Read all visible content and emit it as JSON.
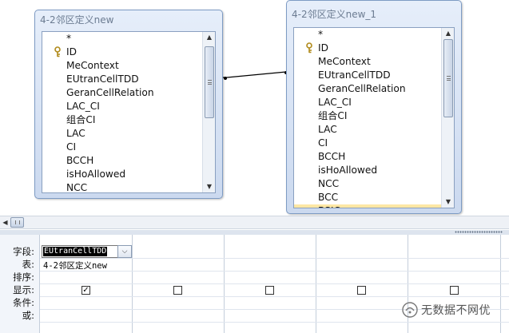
{
  "tables": [
    {
      "title": "4-2邻区定义new",
      "fields": [
        "*",
        "ID",
        "MeContext",
        "EUtranCellTDD",
        "GeranCellRelation",
        "LAC_CI",
        "组合CI",
        "LAC",
        "CI",
        "BCCH",
        "isHoAllowed",
        "NCC"
      ]
    },
    {
      "title": "4-2邻区定义new_1",
      "fields": [
        "*",
        "ID",
        "MeContext",
        "EUtranCellTDD",
        "GeranCellRelation",
        "LAC_CI",
        "组合CI",
        "LAC",
        "CI",
        "BCCH",
        "isHoAllowed",
        "NCC",
        "BCC",
        "BSIC"
      ]
    }
  ],
  "grid": {
    "row_labels": [
      "字段:",
      "表:",
      "排序:",
      "显示:",
      "条件:",
      "或:"
    ],
    "field_value": "EUtranCellTDD",
    "table_value": "4-2邻区定义new",
    "show_checks": [
      true,
      false,
      false,
      false,
      false
    ]
  },
  "watermark": "无数据不网优"
}
